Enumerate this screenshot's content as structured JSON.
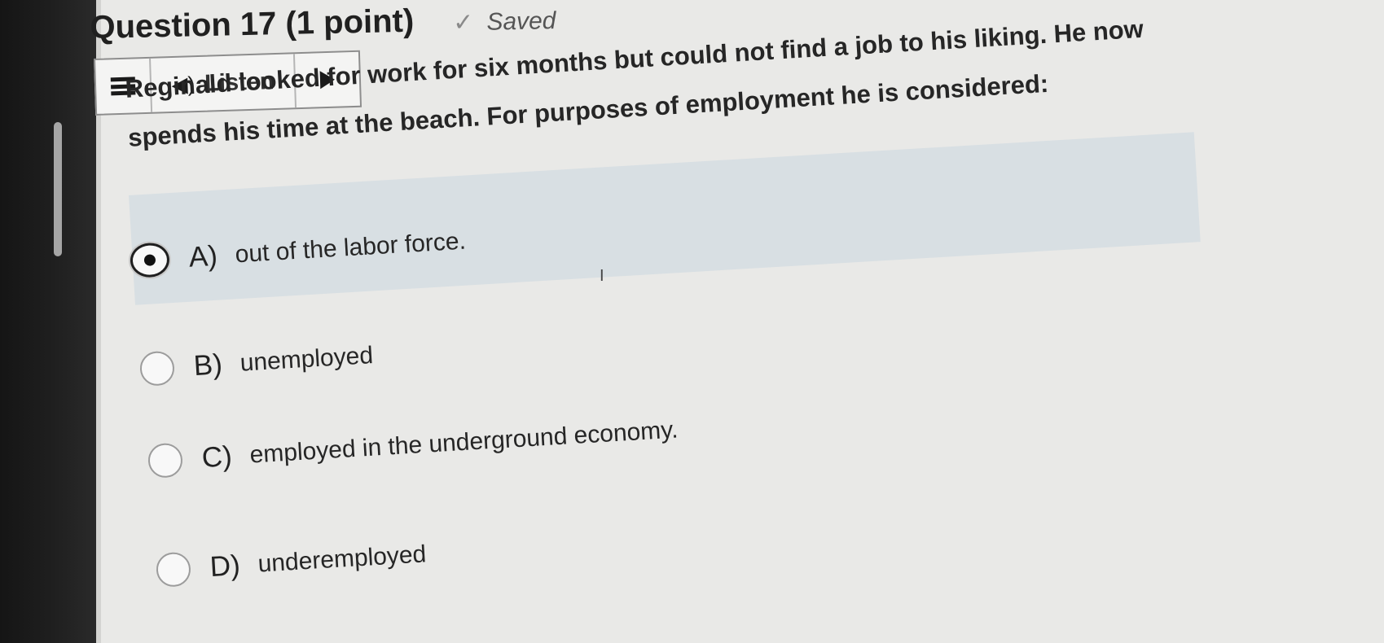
{
  "question": {
    "title": "Question 17 (1 point)",
    "saved_icon": "check-icon",
    "saved_label": "Saved",
    "text": "Reginald looked for work for six months but could not find a job to his liking. He now spends his time at the beach. For purposes of employment he is considered:"
  },
  "toolbar": {
    "menu_icon": "hamburger-menu-icon",
    "speaker_icon": "speaker-icon",
    "listen_label": "Listen",
    "play_icon": "play-icon"
  },
  "options": [
    {
      "letter": "A)",
      "text": "out of the labor force.",
      "selected": true
    },
    {
      "letter": "B)",
      "text": "unemployed",
      "selected": false
    },
    {
      "letter": "C)",
      "text": "employed in the underground economy.",
      "selected": false
    },
    {
      "letter": "D)",
      "text": "underemployed",
      "selected": false
    }
  ],
  "colors": {
    "page_background": "#e9e9e7",
    "selected_highlight": "#d8dfe3",
    "text": "#262626"
  }
}
